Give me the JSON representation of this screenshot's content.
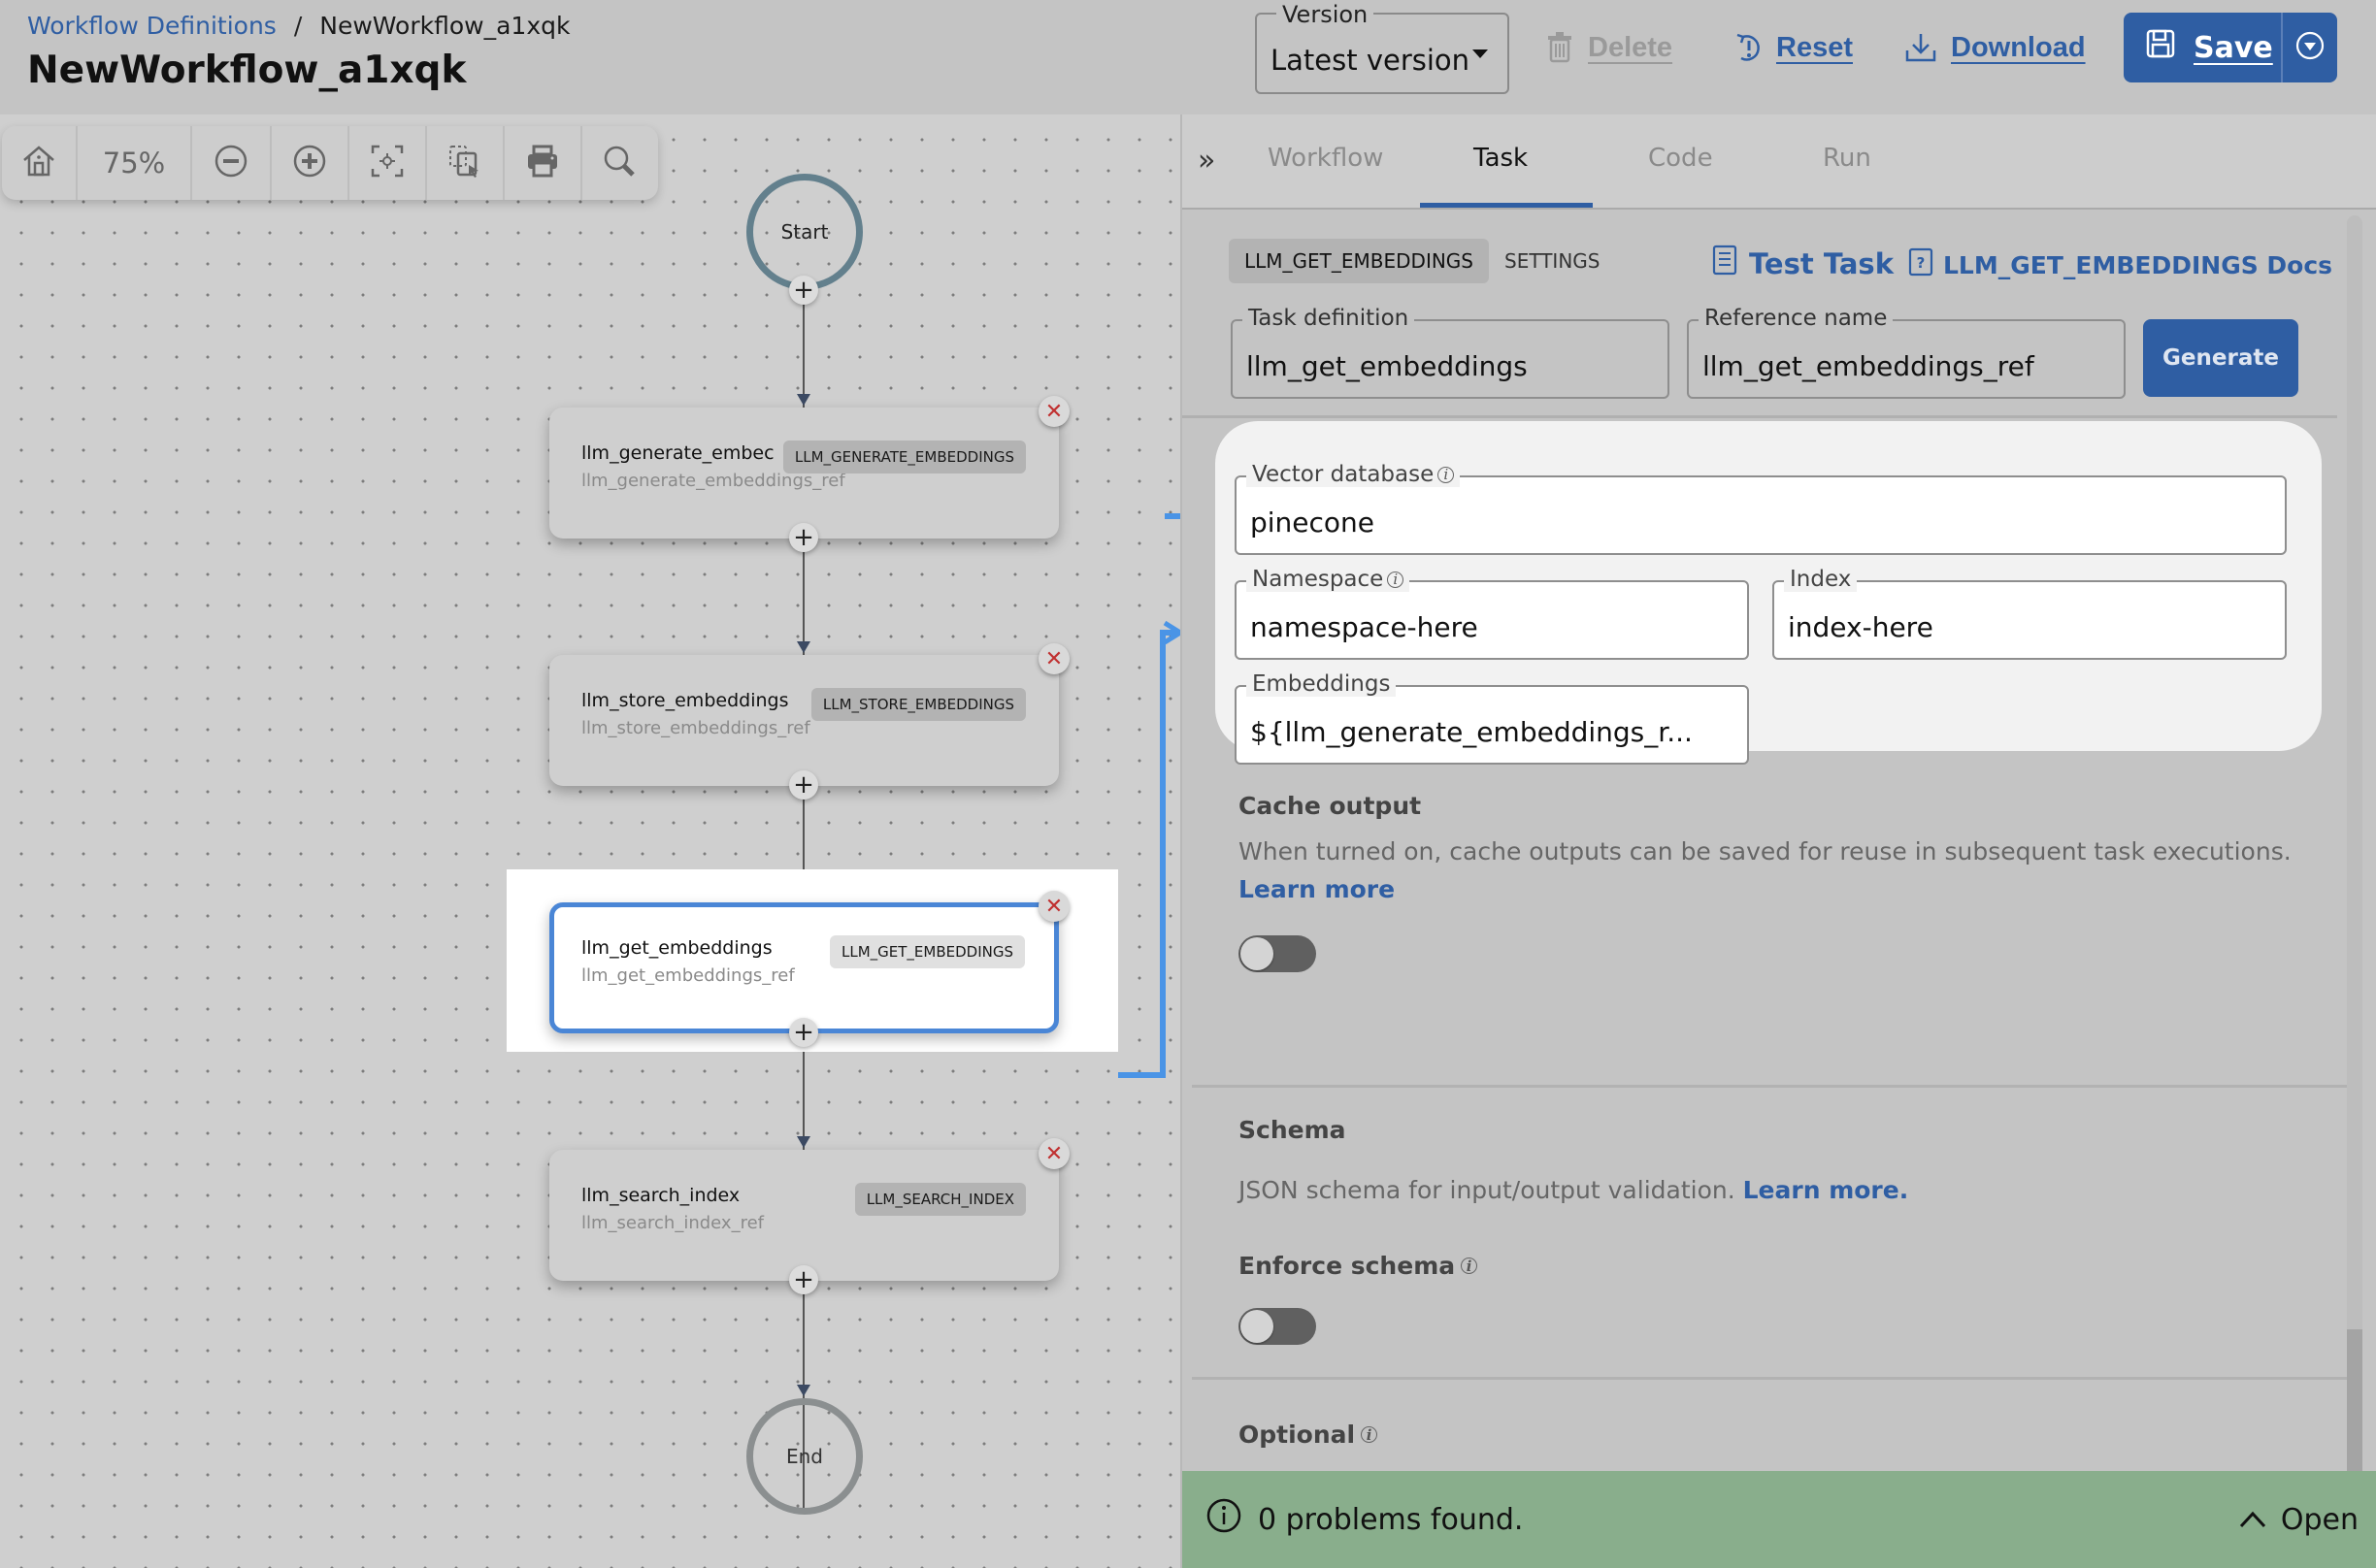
{
  "header": {
    "breadcrumb": {
      "parent": "Workflow Definitions",
      "separator": "/",
      "current": "NewWorkflow_a1xqk"
    },
    "title": "NewWorkflow_a1xqk",
    "version": {
      "label": "Version",
      "selected": "Latest version"
    },
    "actions": {
      "delete": "Delete",
      "reset": "Reset",
      "download": "Download",
      "save": "Save"
    }
  },
  "canvas": {
    "toolbar": {
      "zoom_level": "75%",
      "buttons": [
        "home-icon",
        "zoom-out-icon",
        "zoom-in-icon",
        "fit-view-icon",
        "select-icon",
        "print-icon",
        "search-icon"
      ]
    },
    "start_label": "Start",
    "end_label": "End",
    "tasks": [
      {
        "name": "llm_generate_embec",
        "ref": "llm_generate_embeddings_ref",
        "type": "LLM_GENERATE_EMBEDDINGS",
        "selected": false
      },
      {
        "name": "llm_store_embeddings",
        "ref": "llm_store_embeddings_ref",
        "type": "LLM_STORE_EMBEDDINGS",
        "selected": false
      },
      {
        "name": "llm_get_embeddings",
        "ref": "llm_get_embeddings_ref",
        "type": "LLM_GET_EMBEDDINGS",
        "selected": true
      },
      {
        "name": "llm_search_index",
        "ref": "llm_search_index_ref",
        "type": "LLM_SEARCH_INDEX",
        "selected": false
      }
    ]
  },
  "panel": {
    "tabs": [
      "Workflow",
      "Task",
      "Code",
      "Run"
    ],
    "active_tab": "Task",
    "subtabs": [
      "LLM_GET_EMBEDDINGS",
      "SETTINGS"
    ],
    "test_task": "Test Task",
    "docs_link": "LLM_GET_EMBEDDINGS Docs",
    "task_definition": {
      "label": "Task definition",
      "value": "llm_get_embeddings"
    },
    "reference_name": {
      "label": "Reference name",
      "value": "llm_get_embeddings_ref"
    },
    "generate": "Generate",
    "vector_database": {
      "label": "Vector database",
      "value": "pinecone"
    },
    "namespace": {
      "label": "Namespace",
      "value": "namespace-here"
    },
    "index": {
      "label": "Index",
      "value": "index-here"
    },
    "embeddings": {
      "label": "Embeddings",
      "value": "${llm_generate_embeddings_r..."
    },
    "cache_output": {
      "title": "Cache output",
      "description": "When turned on, cache outputs can be saved for reuse in subsequent task executions.",
      "link": "Learn more",
      "enabled": false
    },
    "schema": {
      "title": "Schema",
      "description": "JSON schema for input/output validation.",
      "link": "Learn more.",
      "enforce_label": "Enforce schema",
      "enforce_enabled": false
    },
    "optional": {
      "title": "Optional"
    },
    "problems": {
      "text": "0 problems found.",
      "open": "Open"
    }
  }
}
